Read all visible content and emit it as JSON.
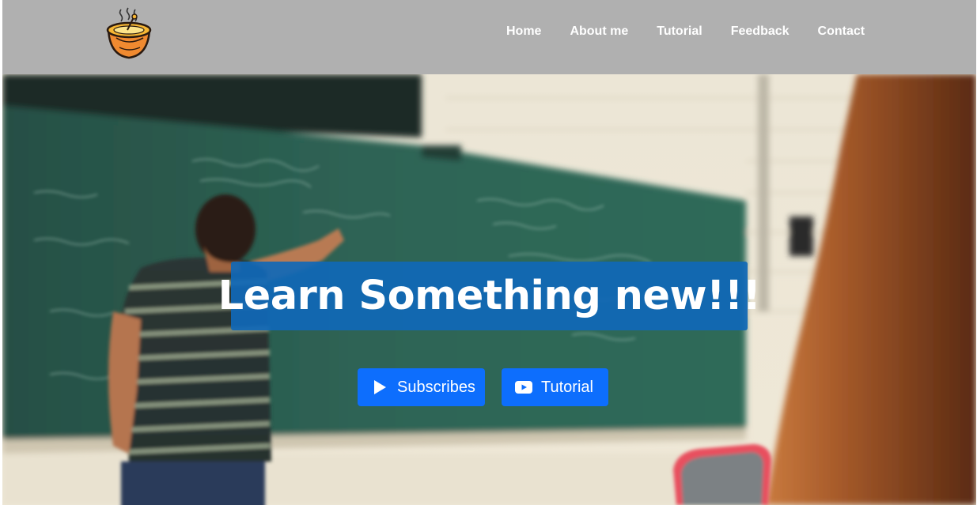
{
  "nav": {
    "logo_icon": "soup-bowl-logo-icon",
    "links": [
      {
        "label": "Home"
      },
      {
        "label": "About me"
      },
      {
        "label": "Tutorial"
      },
      {
        "label": "Feedback"
      },
      {
        "label": "Contact"
      }
    ]
  },
  "hero": {
    "background": "blurred classroom photo: teacher at chalkboard",
    "headline": "Learn Something new!!!",
    "buttons": {
      "subscribe": {
        "label": "Subscribes",
        "icon": "play-icon"
      },
      "tutorial": {
        "label": "Tutorial",
        "icon": "youtube-icon"
      }
    }
  },
  "colors": {
    "navbar_bg": "#b0b0b0",
    "headline_bg": "#1068b7",
    "button_bg": "#0d6efd",
    "text": "#ffffff"
  }
}
